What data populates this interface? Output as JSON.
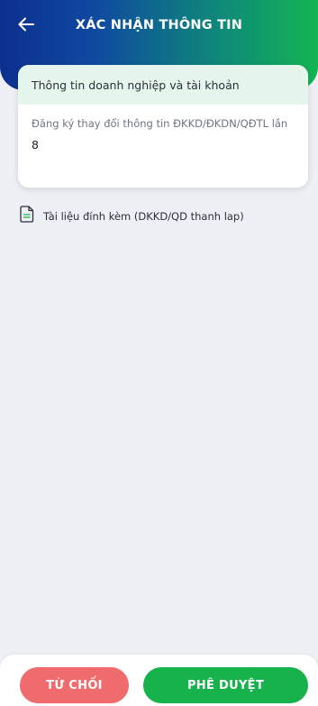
{
  "header": {
    "title": "XÁC NHẬN THÔNG TIN",
    "back_icon": "arrow-left-icon"
  },
  "card": {
    "heading": "Thông tin doanh nghiệp và tài khoản",
    "field_label": "Đăng ký thay đổi thông tin ĐKKD/ĐKDN/QĐTL lần",
    "field_value": "8"
  },
  "attachment": {
    "icon": "document-icon",
    "label": "Tài liệu đính kèm (DKKD/QD thanh lap)"
  },
  "actions": {
    "reject_label": "TỪ CHỐI",
    "approve_label": "PHÊ DUYỆT"
  },
  "colors": {
    "header_gradient_start": "#0d2f8f",
    "header_gradient_end": "#13b553",
    "card_head_bg": "#e7f6ec",
    "reject": "#f06b6e",
    "approve": "#17b24c",
    "page_bg": "#eef0f5"
  }
}
